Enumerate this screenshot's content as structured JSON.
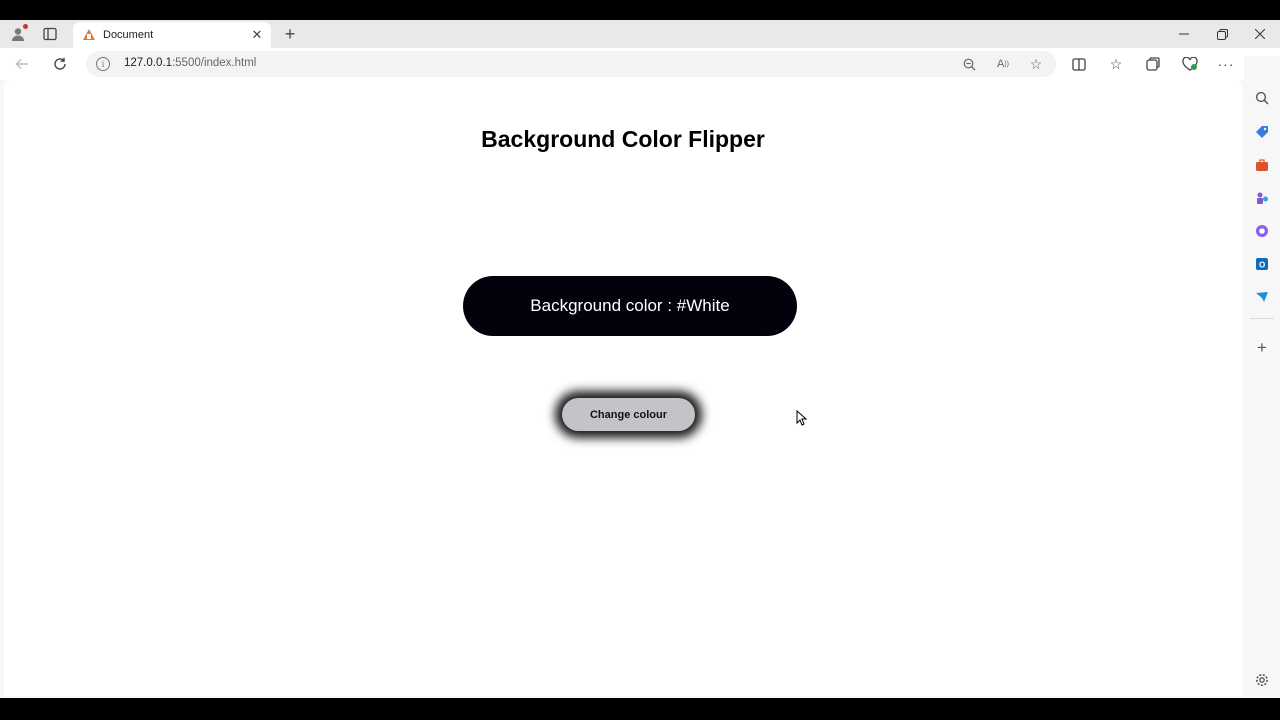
{
  "browser": {
    "tab_title": "Document",
    "url_host": "127.0.0.1",
    "url_rest": ":5500/index.html",
    "new_tab_glyph": "+",
    "close_tab_glyph": "✕"
  },
  "page": {
    "heading": "Background Color Flipper",
    "color_label": "Background color : #White",
    "button_label": "Change colour"
  },
  "icons": {
    "profile": "profile-icon",
    "tab_actions": "tab-actions-icon",
    "back": "back-arrow-icon",
    "reload": "reload-icon",
    "info": "site-info-icon",
    "zoom": "zoom-out-icon",
    "read_aloud": "read-aloud-icon",
    "favorite": "star-icon",
    "split": "split-screen-icon",
    "favorites": "favorites-icon",
    "collections": "collections-icon",
    "browser_essentials": "browser-essentials-icon",
    "more": "more-icon",
    "copilot": "copilot-icon"
  },
  "colors": {
    "pill_background": "#03020c",
    "button_background": "#c2c4c8",
    "page_background": "#ffffff"
  }
}
